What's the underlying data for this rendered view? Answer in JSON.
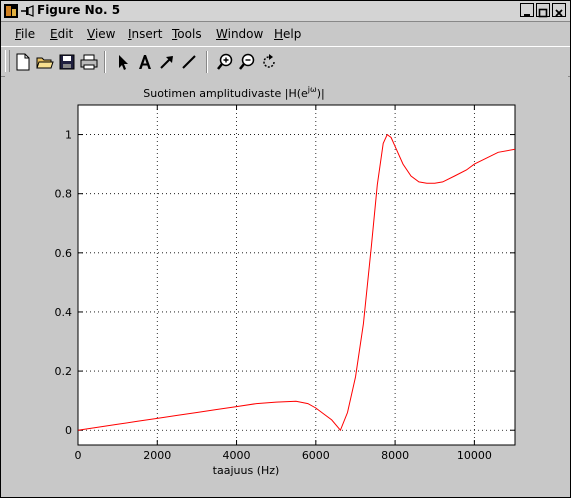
{
  "window": {
    "title": "Figure No. 5"
  },
  "menu": [
    "File",
    "Edit",
    "View",
    "Insert",
    "Tools",
    "Window",
    "Help"
  ],
  "menu_mnemonics": [
    "F",
    "E",
    "V",
    "I",
    "T",
    "W",
    "H"
  ],
  "toolbar": {
    "icons": [
      "new-file-icon",
      "open-folder-icon",
      "save-icon",
      "print-icon",
      "select-arrow-icon",
      "text-tool-icon",
      "arrow-tool-icon",
      "line-tool-icon",
      "zoom-in-icon",
      "zoom-out-icon",
      "rotate-icon"
    ]
  },
  "chart_data": {
    "type": "line",
    "title_main": "Suotimen amplitudivaste |H(e",
    "title_sup": "jω",
    "title_end": ")|",
    "xlabel": "taajuus (Hz)",
    "ylabel": "",
    "xlim": [
      0,
      11025
    ],
    "ylim": [
      -0.05,
      1.1
    ],
    "xticks": [
      0,
      2000,
      4000,
      6000,
      8000,
      10000
    ],
    "yticks": [
      0,
      0.2,
      0.4,
      0.6,
      0.8,
      1
    ],
    "grid": true,
    "line_color": "#ff0000",
    "series": [
      {
        "x": [
          0,
          500,
          1000,
          1500,
          2000,
          2500,
          3000,
          3500,
          4000,
          4500,
          5000,
          5500,
          5800,
          6000,
          6200,
          6400,
          6620,
          6800,
          7000,
          7200,
          7400,
          7550,
          7700,
          7800,
          7900,
          8000,
          8200,
          8400,
          8600,
          8800,
          9000,
          9200,
          9500,
          9800,
          10000,
          10300,
          10600,
          11025
        ],
        "y": [
          0,
          0.01,
          0.02,
          0.03,
          0.04,
          0.05,
          0.06,
          0.07,
          0.08,
          0.09,
          0.095,
          0.098,
          0.09,
          0.075,
          0.055,
          0.035,
          0.0,
          0.06,
          0.18,
          0.36,
          0.62,
          0.83,
          0.97,
          1.0,
          0.99,
          0.96,
          0.9,
          0.86,
          0.84,
          0.835,
          0.835,
          0.84,
          0.86,
          0.88,
          0.9,
          0.92,
          0.94,
          0.95
        ]
      }
    ]
  }
}
